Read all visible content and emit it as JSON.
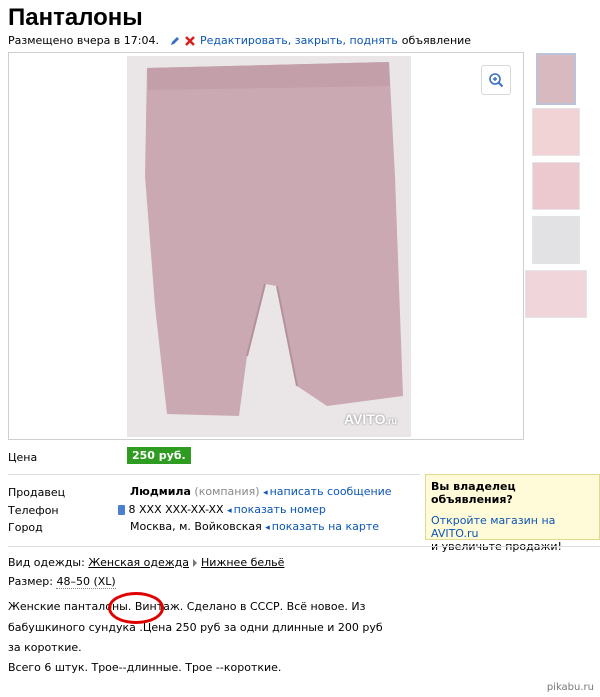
{
  "title": "Панталоны",
  "posted": {
    "text": "Размещено вчера в 17:04.",
    "actions_link": "Редактировать, закрыть, поднять",
    "actions_suffix": "объявление"
  },
  "gallery": {
    "watermark": "AVITO",
    "watermark_suffix": ".ru",
    "zoom_icon": "zoom-in-icon",
    "thumbnail_colors": [
      "#d8b9c0",
      "#f1d3d6",
      "#ebc9cf",
      "#e2e2e4",
      "#f0d5da"
    ]
  },
  "price": {
    "label": "Цена",
    "value": "250 руб."
  },
  "seller": {
    "label": "Продавец",
    "name": "Людмила",
    "type": "(компания)",
    "message_link": "написать сообщение"
  },
  "phone": {
    "label": "Телефон",
    "value": "8 XXX XXX-XX-XX",
    "show_link": "показать номер"
  },
  "city": {
    "label": "Город",
    "value": "Москва, м. Войковская",
    "map_link": "показать на карте"
  },
  "owner_box": {
    "heading": "Вы владелец объявления?",
    "link": "Откройте магазин на AVITO.ru",
    "text": "и увеличьте продажи!"
  },
  "details": {
    "type_label": "Вид одежды:",
    "crumb1": "Женская одежда",
    "crumb2": "Нижнее бельё",
    "size_label": "Размер:",
    "size_value": "48–50 (XL)"
  },
  "description": {
    "line1": "Женские панталоны. Винтаж. Сделано в СССР. Всё новое. Из",
    "line2": "бабушкиного сундука .Цена 250 руб за одни длинные и 200 руб",
    "line3": "за короткие.",
    "line4": "Всего 6 штук. Трое--длинные. Трое --короткие."
  },
  "site_watermark": "pikabu.ru",
  "colors": {
    "link": "#0b55b5",
    "price_bg": "#2e9b21",
    "annotation": "#e00000",
    "owner_box_bg": "#fffbd9"
  }
}
